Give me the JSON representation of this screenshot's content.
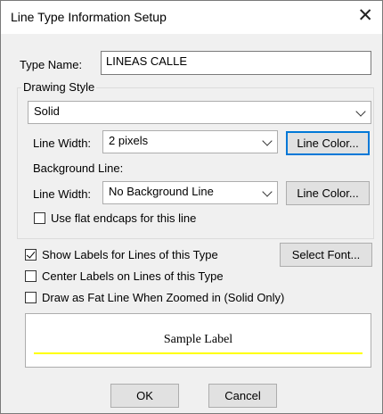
{
  "window": {
    "title": "Line Type Information Setup",
    "close_glyph": "✕"
  },
  "type_name": {
    "label": "Type Name:",
    "value": "LINEAS CALLE"
  },
  "drawing_style": {
    "group_label": "Drawing Style",
    "style_value": "Solid",
    "line_width_label": "Line Width:",
    "line_width_value": "2 pixels",
    "line_color_button": "Line Color...",
    "background_line_label": "Background Line:",
    "bg_line_width_label": "Line Width:",
    "bg_line_width_value": "No Background Line",
    "bg_line_color_button": "Line Color...",
    "flat_endcaps_label": "Use flat endcaps for this line",
    "flat_endcaps_checked": false
  },
  "options": {
    "show_labels_label": "Show Labels for Lines of this Type",
    "show_labels_checked": true,
    "select_font_button": "Select Font...",
    "center_labels_label": "Center Labels on Lines of this Type",
    "center_labels_checked": false,
    "fat_line_label": "Draw as Fat Line When Zoomed in (Solid Only)",
    "fat_line_checked": false
  },
  "sample": {
    "text": "Sample Label",
    "line_color": "#ffff00"
  },
  "buttons": {
    "ok": "OK",
    "cancel": "Cancel"
  }
}
